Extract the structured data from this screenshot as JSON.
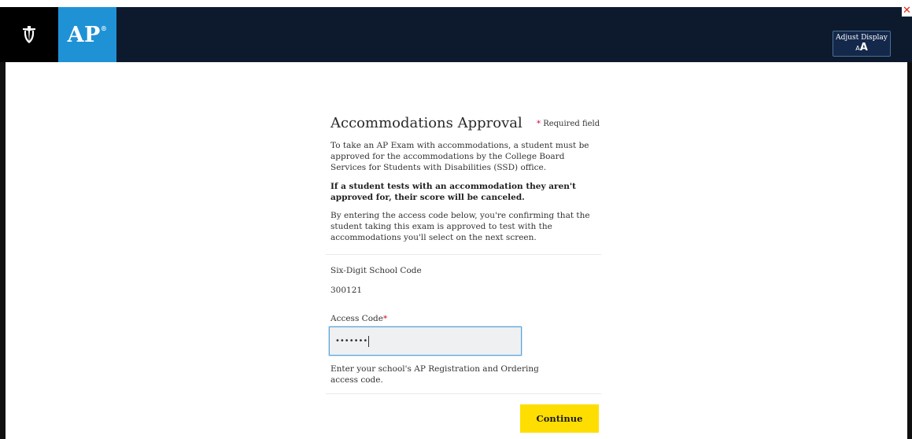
{
  "header": {
    "logo_icon": "acorn-icon",
    "ap_logo_text": "AP",
    "ap_logo_mark": "®",
    "adjust_display": {
      "label": "Adjust Display",
      "icon_small": "A",
      "icon_large": "A"
    },
    "close_icon": "close-icon",
    "close_glyph": "✕",
    "colors": {
      "header_bg": "#0d1a2e",
      "ap_blue": "#1f92d6",
      "close_red": "#d9261c"
    }
  },
  "form": {
    "title": "Accommodations Approval",
    "required_star": "*",
    "required_text": "Required field",
    "paragraph_1": "To take an AP Exam with accommodations, a student must be approved for the accommodations by the College Board Services for Students with Disabilities (SSD) office.",
    "paragraph_2": "If a student tests with an accommodation they aren't approved for, their score will be canceled.",
    "paragraph_3": "By entering the access code below, you're confirming that the student taking this exam is approved to test with the accommodations you'll select on the next screen.",
    "school_code_label": "Six-Digit School Code",
    "school_code_value": "300121",
    "access_code_label": "Access Code",
    "access_code_required": "*",
    "access_code_value": "•••••••",
    "access_code_hint": "Enter your school's AP Registration and Ordering access code.",
    "continue_label": "Continue",
    "colors": {
      "button_yellow": "#fede00",
      "required_red": "#c8102e",
      "input_focus": "#5aa3d9"
    }
  }
}
